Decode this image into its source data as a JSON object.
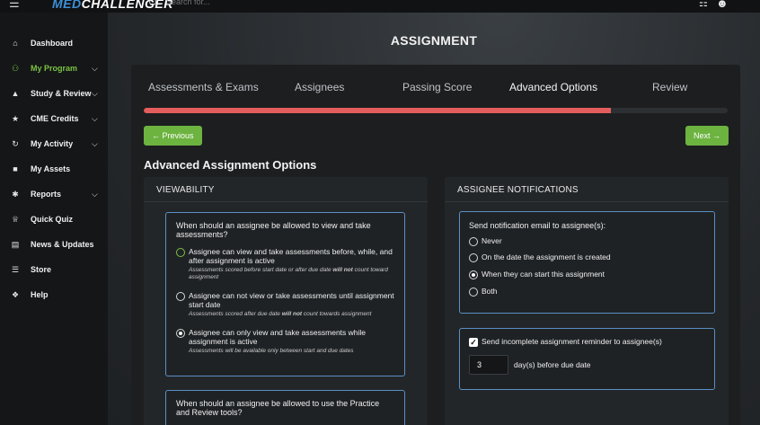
{
  "header": {
    "logo_part1": "MED",
    "logo_part2": "CHALLENGER",
    "search_placeholder": "Search for..."
  },
  "sidebar": {
    "items": [
      {
        "label": "Dashboard",
        "icon": "dashboard-icon",
        "glyph": "⌂",
        "has_chevron": false
      },
      {
        "label": "My Program",
        "icon": "users-icon",
        "glyph": "⚇",
        "has_chevron": true
      },
      {
        "label": "Study & Review",
        "icon": "graduation-cap-icon",
        "glyph": "▲",
        "has_chevron": true
      },
      {
        "label": "CME Credits",
        "icon": "award-icon",
        "glyph": "★",
        "has_chevron": true
      },
      {
        "label": "My Activity",
        "icon": "history-icon",
        "glyph": "↻",
        "has_chevron": true
      },
      {
        "label": "My Assets",
        "icon": "folder-icon",
        "glyph": "■",
        "has_chevron": false
      },
      {
        "label": "Reports",
        "icon": "reports-icon",
        "glyph": "✱",
        "has_chevron": true
      },
      {
        "label": "Quick Quiz",
        "icon": "trophy-icon",
        "glyph": "♕",
        "has_chevron": false
      },
      {
        "label": "News & Updates",
        "icon": "newspaper-icon",
        "glyph": "▤",
        "has_chevron": false
      },
      {
        "label": "Store",
        "icon": "cart-icon",
        "glyph": "☰",
        "has_chevron": false
      },
      {
        "label": "Help",
        "icon": "help-icon",
        "glyph": "❖",
        "has_chevron": false
      }
    ],
    "chevron": "⌵"
  },
  "page": {
    "title": "ASSIGNMENT"
  },
  "steps": [
    {
      "label": "Assessments & Exams"
    },
    {
      "label": "Assignees"
    },
    {
      "label": "Passing Score"
    },
    {
      "label": "Advanced Options"
    },
    {
      "label": "Review"
    }
  ],
  "progress": {
    "percent": 80
  },
  "nav_buttons": {
    "previous": "← Previous",
    "next": "Next →"
  },
  "section_title": "Advanced Assignment Options",
  "viewability": {
    "header": "VIEWABILITY",
    "question1": "When should an assignee be allowed to view and take assessments?",
    "options": [
      {
        "label": "Assignee can view and take assessments before, while, and after assignment is active",
        "note_before": "Assessments scored before start date or after due date ",
        "note_bold": "will not",
        "note_after": " count toward assignment",
        "selected": false
      },
      {
        "label": "Assignee can not view or take assessments until assignment start date",
        "note_before": "Assessments scored after due date ",
        "note_bold": "will not",
        "note_after": " count towards assignment",
        "selected": false
      },
      {
        "label": "Assignee can only view and take assessments while assignment is active",
        "note_before": "Assessments will be available only between start and due dates",
        "note_bold": "",
        "note_after": "",
        "selected": true
      }
    ],
    "question2": "When should an assignee be allowed to use the Practice and Review tools?"
  },
  "notifications": {
    "header": "ASSIGNEE NOTIFICATIONS",
    "question": "Send notification email to assignee(s):",
    "options": [
      {
        "label": "Never",
        "selected": false
      },
      {
        "label": "On the date the assignment is created",
        "selected": false
      },
      {
        "label": "When they can start this assignment",
        "selected": true
      },
      {
        "label": "Both",
        "selected": false
      }
    ],
    "reminder_label": "Send incomplete assignment reminder to assignee(s)",
    "reminder_checked": true,
    "days_value": "3",
    "days_label": "day(s) before due date"
  },
  "colors": {
    "accent_green": "#6cb33f",
    "progress_red": "#e35d5d",
    "box_border_blue": "#5a8fc4"
  }
}
